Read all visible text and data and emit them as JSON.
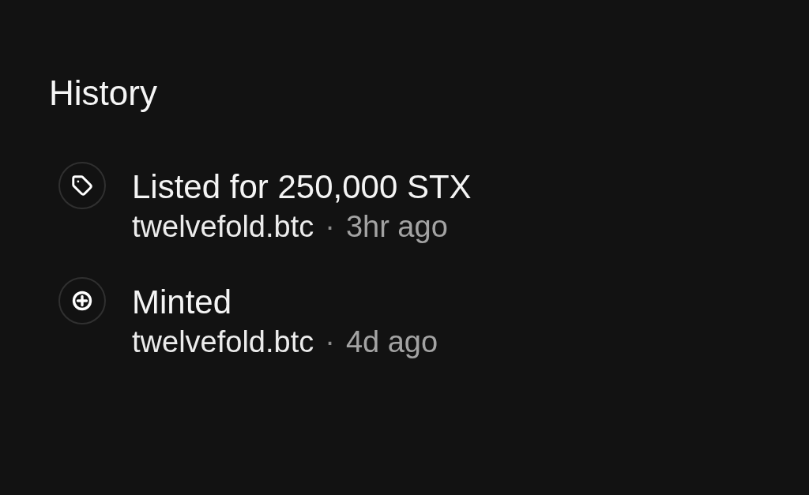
{
  "title": "History",
  "events": [
    {
      "kind": "listed",
      "title": "Listed for 250,000 STX",
      "user": "twelvefold.btc",
      "separator": "·",
      "time": "3hr ago"
    },
    {
      "kind": "minted",
      "title": "Minted",
      "user": "twelvefold.btc",
      "separator": "·",
      "time": "4d ago"
    }
  ]
}
